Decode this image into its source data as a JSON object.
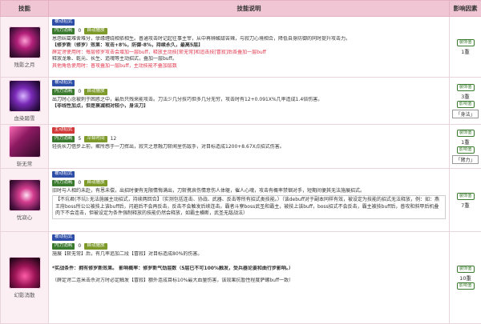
{
  "header": {
    "col_skill": "技能",
    "col_desc": "技能说明",
    "col_impact": "影响因素"
  },
  "rows": [
    {
      "name": "残影之月",
      "tags": [
        "被动招式",
        "内力消耗"
      ],
      "num": "0",
      "tag3": "自动施放",
      "lines": [
        "恩怨纠葛难舍难分，孽缘缠绕相依相生。普通攻击时记起往事主宰，从中再辨酸甜苦辣，与寂刀心境相合，降低自身防御的同时提升攻击力。",
        "【修罗新（修罗）效果：攻击+8%，防御-8%，持续永久，最高5层】",
        "薛定谔使用时：每层修罗攻击会增加一层buff，释放主动技[斩无常]和追击技[冒寂]后各叠加一层buff",
        "释放龙象、乾元、长生、追魂等主动招式，叠加一层buff。",
        "其他角色使用时：普攻叠加一层buff，主动技能不叠加层数"
      ],
      "impact": {
        "badge": "装饰值",
        "value": "1重"
      }
    },
    {
      "name": "血染踏雪",
      "tags": [
        "被动招式",
        "内力消耗"
      ],
      "num": "0",
      "tag3": "自动施放",
      "lines": [
        "出刀时心念被刺于困惑之中，最后只残来能攻击。刀法少几分技巧但多几分无穷，攻击时有12+0.091X%几率造成1.4倍伤害。",
        "【非线性加点，但是衰减相对较小，身法刀】"
      ],
      "impact": {
        "badge1": "装饰值",
        "value": "3重",
        "badge2": "影响值",
        "box": "「身法」"
      }
    },
    {
      "name": "斩无常",
      "tags": [
        "主动招式",
        "内力消耗"
      ],
      "num": "5",
      "tag3": "冷却时间",
      "num2": "12",
      "lines": [
        "轻抚长刀借步上前，聚所感于一刀挥出，寂灭之意融刀斩闻里伤敌手，对目标造成1200+8.67X点招式伤害。"
      ],
      "impact": {
        "badge1": "装饰值",
        "value": "1重",
        "badge2": "影响值",
        "box": "「臂力」"
      }
    },
    {
      "name": "忧寂心",
      "tags": [
        "被动招式",
        "内力消耗"
      ],
      "num": "0",
      "tag3": "自动施放",
      "lines": [
        "旧时与人相约未赴，有恩未偿，出招时便有无限情悔满出，刀斩携哀伤情意伤人体躯，催人心魂，攻击有概率禁锢对手，短期间便其无法施展招式。",
        "【不坑君(不坑):无法施展主动招式，持续两回合】（实测包括连击、协战、武器、反击等所有招式类技能。）（该debuff对于副本同样有效，被设定为技能的招式无法释放，例：如：燕王府boss所公公被技上该buff后，闪避后不会再反击，反击不会触发后续连击。霸者斗寮boss武圣和霸主，被技上该buff，boss招式不会反击，霸主被技buff后，普攻和斜甲后机叠肉下不会连击，但被设定为条件强制释放的技能仍然会释放，如霸主横断，武圣无敌战法）"
      ],
      "impact": {
        "badge": "装饰值",
        "value": "7重"
      }
    },
    {
      "name": "幻影消散",
      "tags": [
        "被动招式",
        "内力消耗"
      ],
      "num": "0",
      "tag3": "自动施放",
      "lines": [
        "施展【斩无常】后，有几率追加二段【冒寂】对目标造成80%的伤害。",
        "*实战条件：拥有修罗新效果。  影响概率：修罗新气劲层数（5层已不可100%触发，受兵器论要和曲行步影响。）",
        "（薛定谔二连米击杀对方时必定触发【冒寂】额外连成目标10%最大血量伤害，该效果抗暂性程度萨螺buff一致）"
      ],
      "impact": {
        "badge1": "装饰值",
        "value": "10重",
        "badge2": "影响值"
      }
    }
  ]
}
